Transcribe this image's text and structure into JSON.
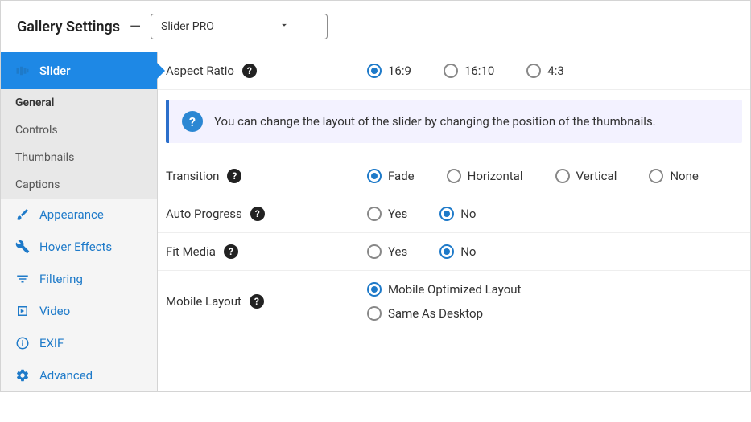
{
  "header": {
    "title": "Gallery Settings",
    "dash": "—",
    "selected": "Slider PRO"
  },
  "sidebar": {
    "active": "Slider",
    "subitems": [
      "General",
      "Controls",
      "Thumbnails",
      "Captions"
    ],
    "navitems": [
      "Appearance",
      "Hover Effects",
      "Filtering",
      "Video",
      "EXIF",
      "Advanced"
    ]
  },
  "rows": {
    "aspect": {
      "label": "Aspect Ratio",
      "opts": [
        "16:9",
        "16:10",
        "4:3"
      ],
      "selected": "16:9"
    },
    "transition": {
      "label": "Transition",
      "opts": [
        "Fade",
        "Horizontal",
        "Vertical",
        "None"
      ],
      "selected": "Fade"
    },
    "autoprog": {
      "label": "Auto Progress",
      "opts": [
        "Yes",
        "No"
      ],
      "selected": "No"
    },
    "fitmedia": {
      "label": "Fit Media",
      "opts": [
        "Yes",
        "No"
      ],
      "selected": "No"
    },
    "mobile": {
      "label": "Mobile Layout",
      "opts": [
        "Mobile Optimized Layout",
        "Same As Desktop"
      ],
      "selected": "Mobile Optimized Layout"
    }
  },
  "info": "You can change the layout of the slider by changing the position of the thumbnails."
}
